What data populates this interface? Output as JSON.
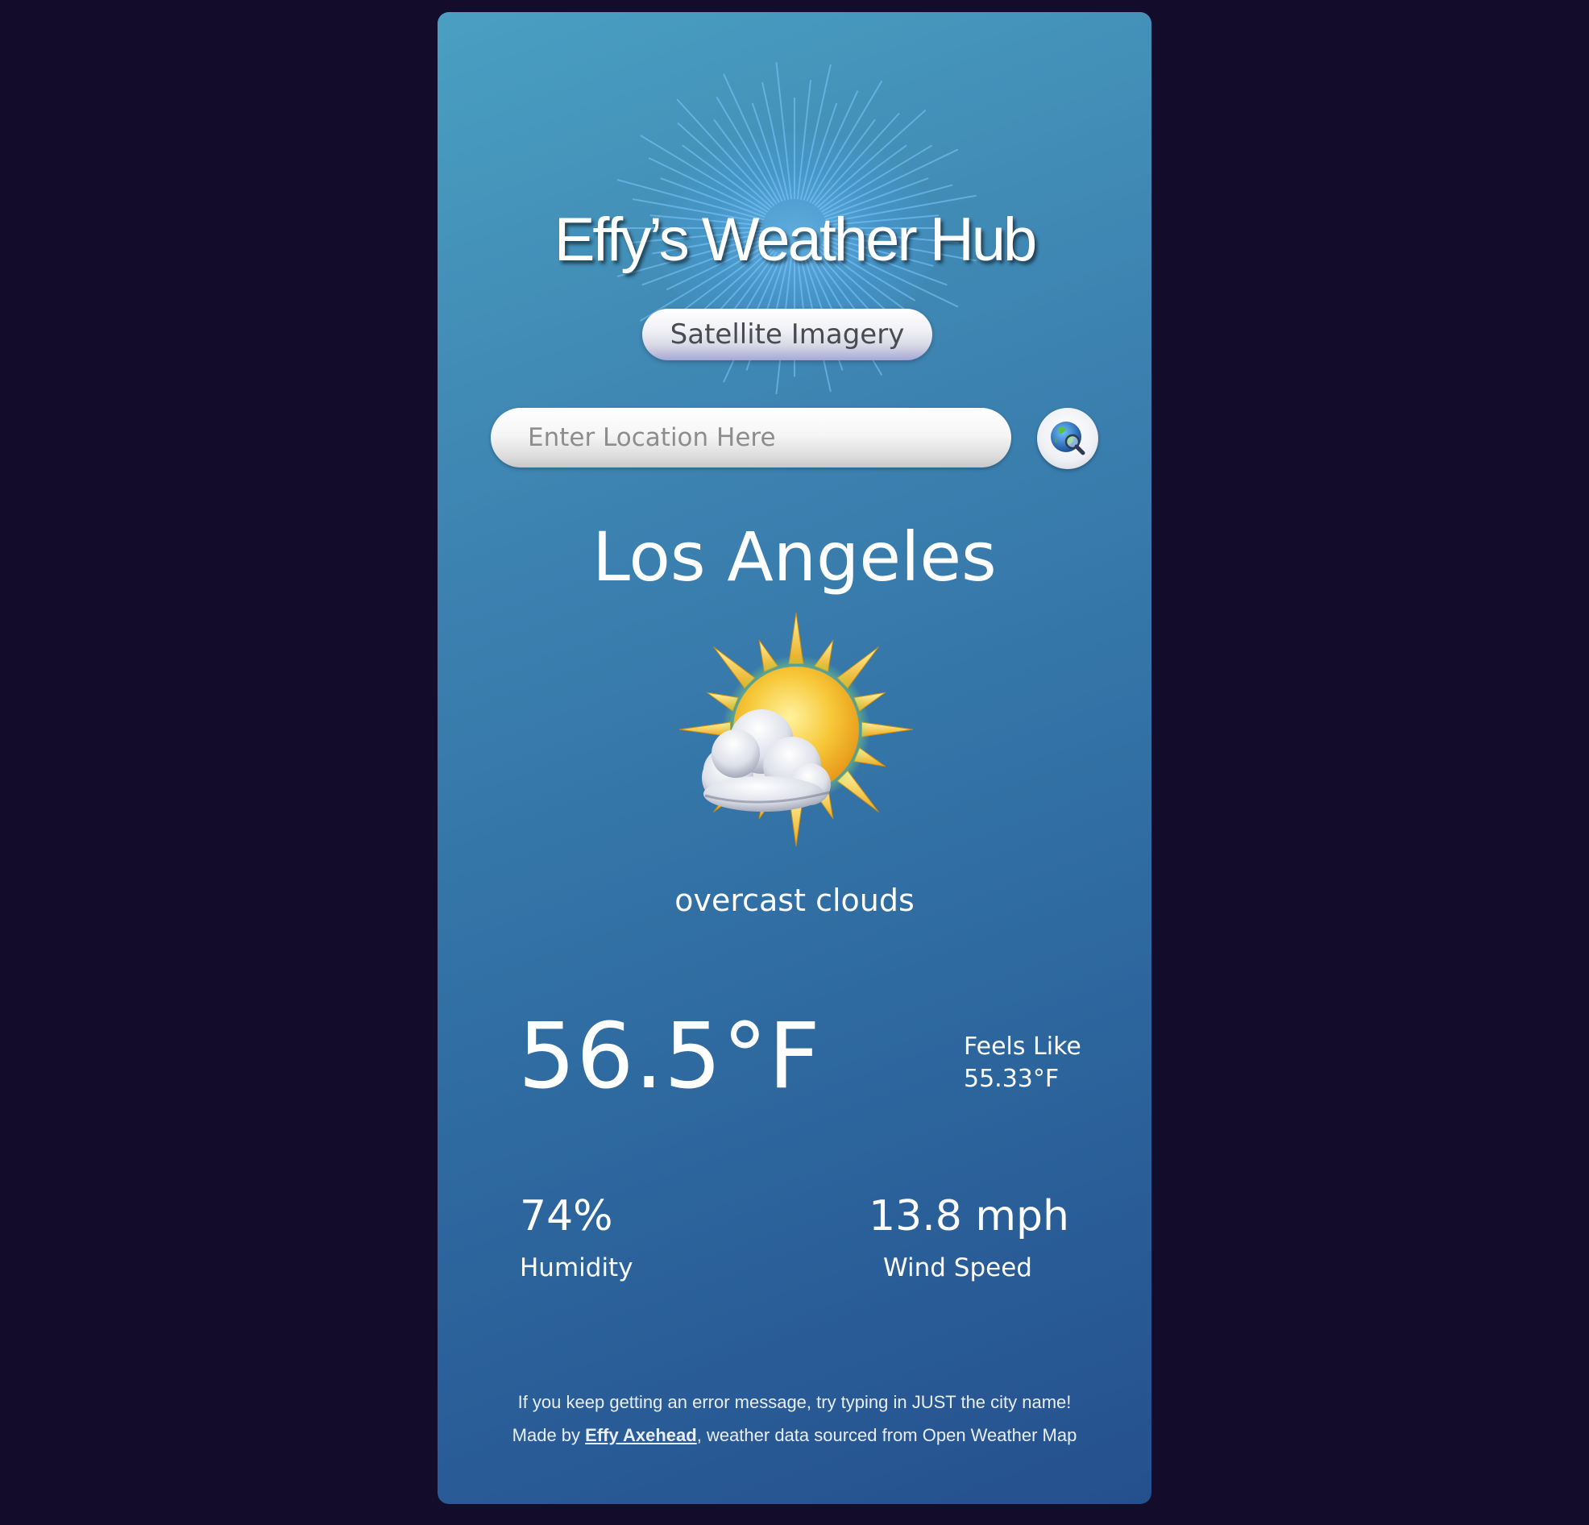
{
  "app": {
    "title": "Effy’s Weather Hub",
    "satellite_button": "Satellite Imagery"
  },
  "search": {
    "placeholder": "Enter Location Here",
    "value": "",
    "button_icon": "globe-search-icon"
  },
  "weather": {
    "city": "Los Angeles",
    "icon": "partly-cloudy-sun-icon",
    "description": "overcast clouds",
    "temperature": "56.5°F",
    "feels_like_label": "Feels Like",
    "feels_like_value": "55.33°F",
    "humidity_value": "74%",
    "humidity_label": "Humidity",
    "wind_value": "13.8 mph",
    "wind_label": "Wind Speed"
  },
  "footer": {
    "tip": "If you keep getting an error message, try typing in JUST the city name!",
    "made_by_prefix": "Made by ",
    "author": "Effy Axehead",
    "suffix": ", weather data sourced from Open Weather Map"
  },
  "colors": {
    "page_background": "#130c2b",
    "card_top": "#4a9fc2",
    "card_bottom": "#25508e",
    "text": "#ffffff"
  }
}
